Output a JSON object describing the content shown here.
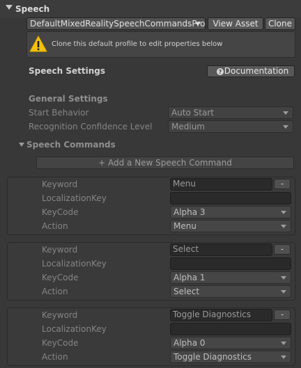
{
  "header": {
    "title": "Speech"
  },
  "profile": {
    "selected": "DefaultMixedRealitySpeechCommandsPro",
    "view_asset_label": "View Asset",
    "clone_label": "Clone"
  },
  "help": {
    "message": "Clone this default profile to edit properties below",
    "icon": "warning-icon"
  },
  "speech_settings": {
    "title": "Speech Settings",
    "documentation_label": "Documentation",
    "doc_icon": "question-icon"
  },
  "general": {
    "title": "General Settings",
    "start_behavior_label": "Start Behavior",
    "start_behavior_value": "Auto Start",
    "confidence_label": "Recognition Confidence Level",
    "confidence_value": "Medium"
  },
  "commands": {
    "title": "Speech Commands",
    "add_label": "+ Add a New Speech Command",
    "field_labels": {
      "keyword": "Keyword",
      "localization": "LocalizationKey",
      "keycode": "KeyCode",
      "action": "Action"
    },
    "remove_label": "-",
    "items": [
      {
        "keyword": "Menu",
        "localization_key": "",
        "keycode": "Alpha 3",
        "action": "Menu"
      },
      {
        "keyword": "Select",
        "localization_key": "",
        "keycode": "Alpha 1",
        "action": "Select"
      },
      {
        "keyword": "Toggle Diagnostics",
        "localization_key": "",
        "keycode": "Alpha 0",
        "action": "Toggle Diagnostics"
      }
    ]
  }
}
